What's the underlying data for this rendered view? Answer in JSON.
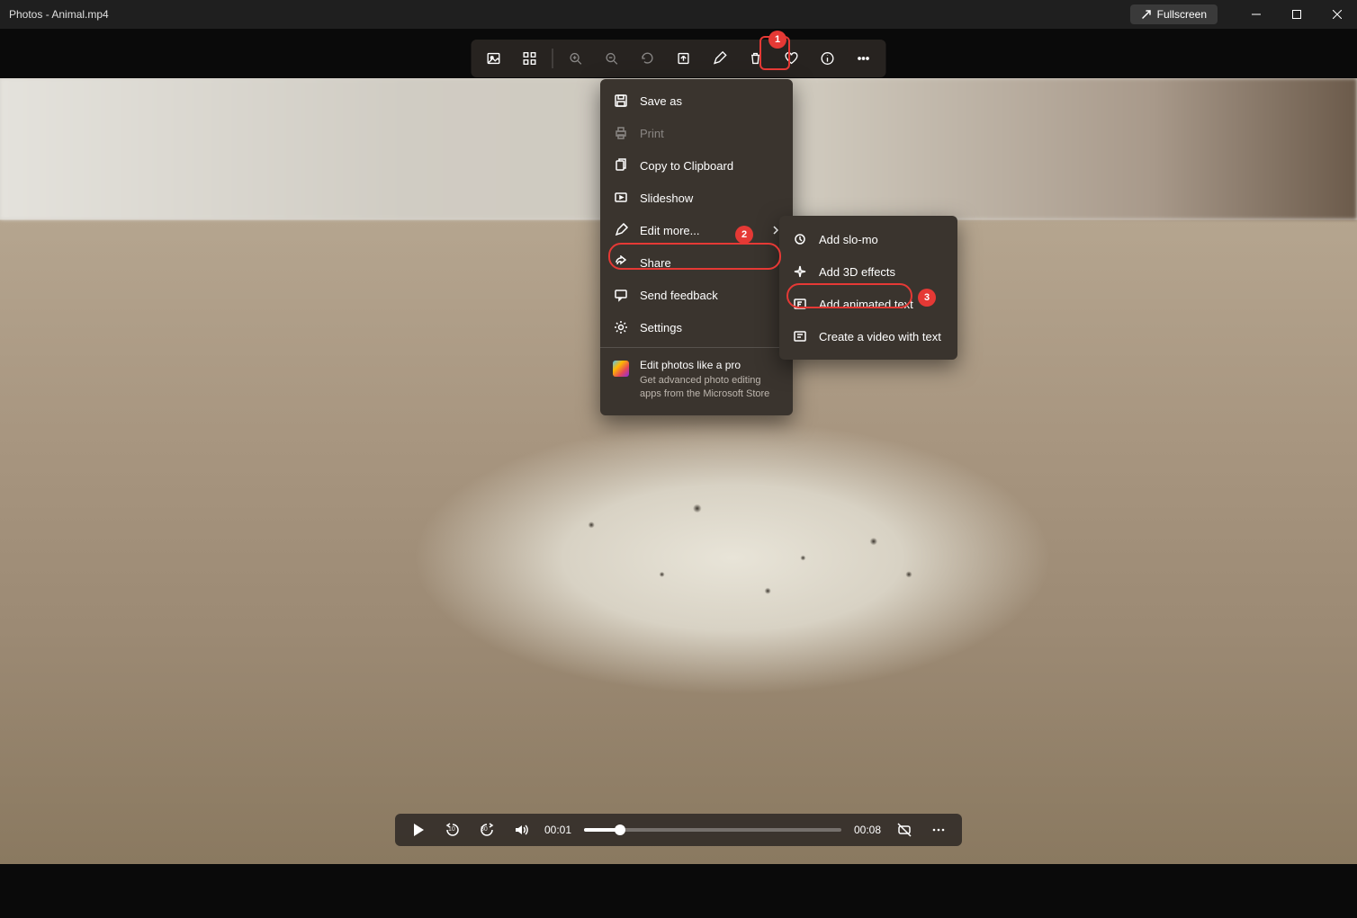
{
  "titlebar": {
    "title": "Photos - Animal.mp4",
    "fullscreen": "Fullscreen"
  },
  "toolbar": {
    "items": [
      "view-photo",
      "film-strip",
      "zoom-in",
      "zoom-out",
      "rotate",
      "slideshow",
      "draw",
      "delete",
      "favorite",
      "info",
      "more"
    ]
  },
  "menu": {
    "save_as": "Save as",
    "print": "Print",
    "copy": "Copy to Clipboard",
    "slideshow": "Slideshow",
    "edit_more": "Edit more...",
    "share": "Share",
    "feedback": "Send feedback",
    "settings": "Settings",
    "promo_title": "Edit photos like a pro",
    "promo_sub": "Get advanced photo editing apps from the Microsoft Store"
  },
  "submenu": {
    "slomo": "Add slo-mo",
    "effects3d": "Add 3D effects",
    "animtext": "Add animated text",
    "videotext": "Create a video with text"
  },
  "player": {
    "current": "00:01",
    "total": "00:08",
    "skip_back": "10",
    "skip_fwd": "30"
  },
  "annotations": {
    "b1": "1",
    "b2": "2",
    "b3": "3"
  }
}
